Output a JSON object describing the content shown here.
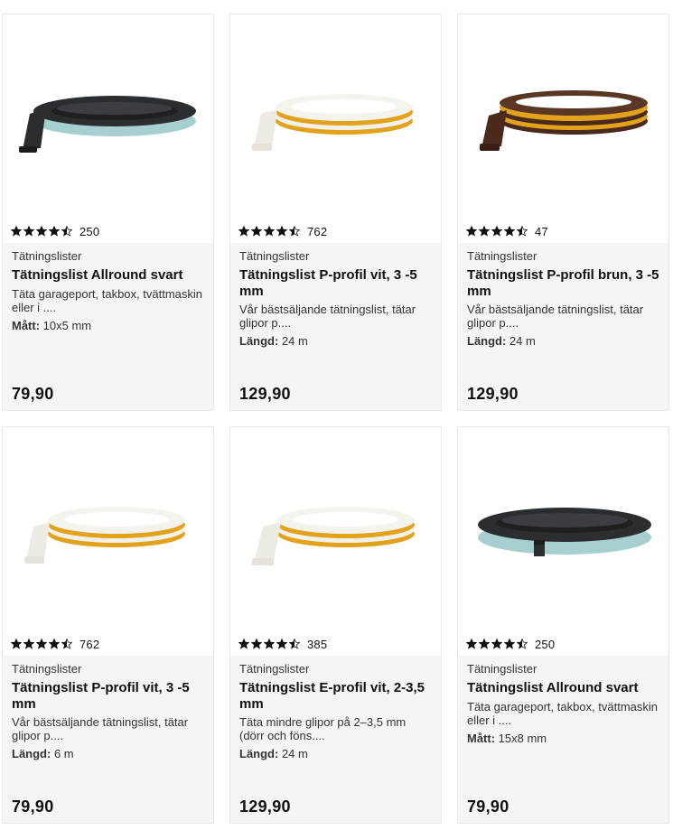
{
  "products": [
    {
      "rating_count": "250",
      "rating_value": 4.5,
      "category": "Tätningslister",
      "title": "Tätningslist Allround svart",
      "description": "Täta garageport, takbox, tvättmaskin eller i ....",
      "spec_label": "Mått:",
      "spec_value": " 10x5 mm",
      "price": "79,90",
      "image_icon": "black-seal-strip-roll"
    },
    {
      "rating_count": "762",
      "rating_value": 4.5,
      "category": "Tätningslister",
      "title": "Tätningslist P-profil vit, 3 -5 mm",
      "description": "Vår bästsäljande tätningslist, tätar glipor p....",
      "spec_label": "Längd:",
      "spec_value": " 24 m",
      "price": "129,90",
      "image_icon": "white-seal-strip-roll"
    },
    {
      "rating_count": "47",
      "rating_value": 4.5,
      "category": "Tätningslister",
      "title": "Tätningslist P-profil brun, 3 -5 mm",
      "description": "Vår bästsäljande tätningslist, tätar glipor p....",
      "spec_label": "Längd:",
      "spec_value": " 24 m",
      "price": "129,90",
      "image_icon": "brown-seal-strip-roll"
    },
    {
      "rating_count": "762",
      "rating_value": 4.5,
      "category": "Tätningslister",
      "title": "Tätningslist P-profil vit, 3 -5 mm",
      "description": "Vår bästsäljande tätningslist, tätar glipor p....",
      "spec_label": "Längd:",
      "spec_value": " 6 m",
      "price": "79,90",
      "image_icon": "white-seal-strip-roll"
    },
    {
      "rating_count": "385",
      "rating_value": 4.5,
      "category": "Tätningslister",
      "title": "Tätningslist E-profil vit, 2-3,5 mm",
      "description": "Täta mindre glipor på 2–3,5 mm (dörr och föns....",
      "spec_label": "Längd:",
      "spec_value": " 24 m",
      "price": "129,90",
      "image_icon": "white-seal-strip-roll"
    },
    {
      "rating_count": "250",
      "rating_value": 4.5,
      "category": "Tätningslister",
      "title": "Tätningslist Allround svart",
      "description": "Täta garageport, takbox, tvättmaskin eller i ....",
      "spec_label": "Mått:",
      "spec_value": " 15x8 mm",
      "price": "79,90",
      "image_icon": "black-seal-strip-roll"
    }
  ],
  "colors": {
    "card_border": "#e9e9e9",
    "info_bg": "#f5f5f5",
    "text": "#111111",
    "black_strip": "#2b2e31",
    "black_strip_tape": "#a8cfcf",
    "white_strip": "#f3f1ec",
    "yellow_tape": "#e2a21c",
    "brown_strip": "#4a2a1c"
  }
}
